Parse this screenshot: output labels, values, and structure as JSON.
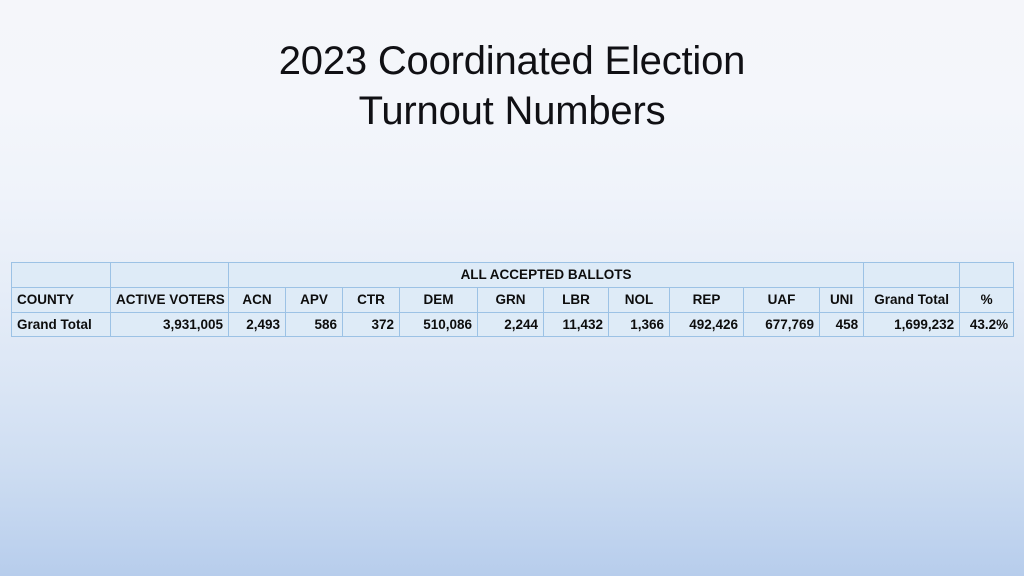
{
  "slide": {
    "title": "2023 Coordinated Election\nTurnout Numbers",
    "background_top_color": "#F5F6FA",
    "background_bottom_color": "#B7CDEC"
  },
  "table": {
    "band_header": "ALL ACCEPTED BALLOTS",
    "colors": {
      "cell_fill": "#DEEBF7",
      "border": "#9CC2E5",
      "highlight_fill": "#9DC3E6",
      "text": "#0D0D0D"
    },
    "columns": [
      {
        "key": "county",
        "label": "COUNTY",
        "align": "left",
        "group": null
      },
      {
        "key": "active_voters",
        "label": "ACTIVE VOTERS",
        "align": "right",
        "group": null
      },
      {
        "key": "acn",
        "label": "ACN",
        "align": "right",
        "group": "ALL ACCEPTED BALLOTS"
      },
      {
        "key": "apv",
        "label": "APV",
        "align": "right",
        "group": "ALL ACCEPTED BALLOTS"
      },
      {
        "key": "ctr",
        "label": "CTR",
        "align": "right",
        "group": "ALL ACCEPTED BALLOTS"
      },
      {
        "key": "dem",
        "label": "DEM",
        "align": "right",
        "group": "ALL ACCEPTED BALLOTS"
      },
      {
        "key": "grn",
        "label": "GRN",
        "align": "right",
        "group": "ALL ACCEPTED BALLOTS"
      },
      {
        "key": "lbr",
        "label": "LBR",
        "align": "right",
        "group": "ALL ACCEPTED BALLOTS"
      },
      {
        "key": "nol",
        "label": "NOL",
        "align": "right",
        "group": "ALL ACCEPTED BALLOTS"
      },
      {
        "key": "rep",
        "label": "REP",
        "align": "right",
        "group": "ALL ACCEPTED BALLOTS"
      },
      {
        "key": "uaf",
        "label": "UAF",
        "align": "right",
        "group": "ALL ACCEPTED BALLOTS"
      },
      {
        "key": "uni",
        "label": "UNI",
        "align": "right",
        "group": "ALL ACCEPTED BALLOTS"
      },
      {
        "key": "grand_total",
        "label": "Grand Total",
        "align": "right",
        "group": null
      },
      {
        "key": "percent",
        "label": "%",
        "align": "right",
        "group": null
      }
    ],
    "rows": [
      {
        "county": "Grand Total",
        "active_voters": "3,931,005",
        "acn": "2,493",
        "apv": "586",
        "ctr": "372",
        "dem": "510,086",
        "grn": "2,244",
        "lbr": "11,432",
        "nol": "1,366",
        "rep": "492,426",
        "uaf": "677,769",
        "uni": "458",
        "grand_total": "1,699,232",
        "percent": "43.2%"
      }
    ]
  }
}
